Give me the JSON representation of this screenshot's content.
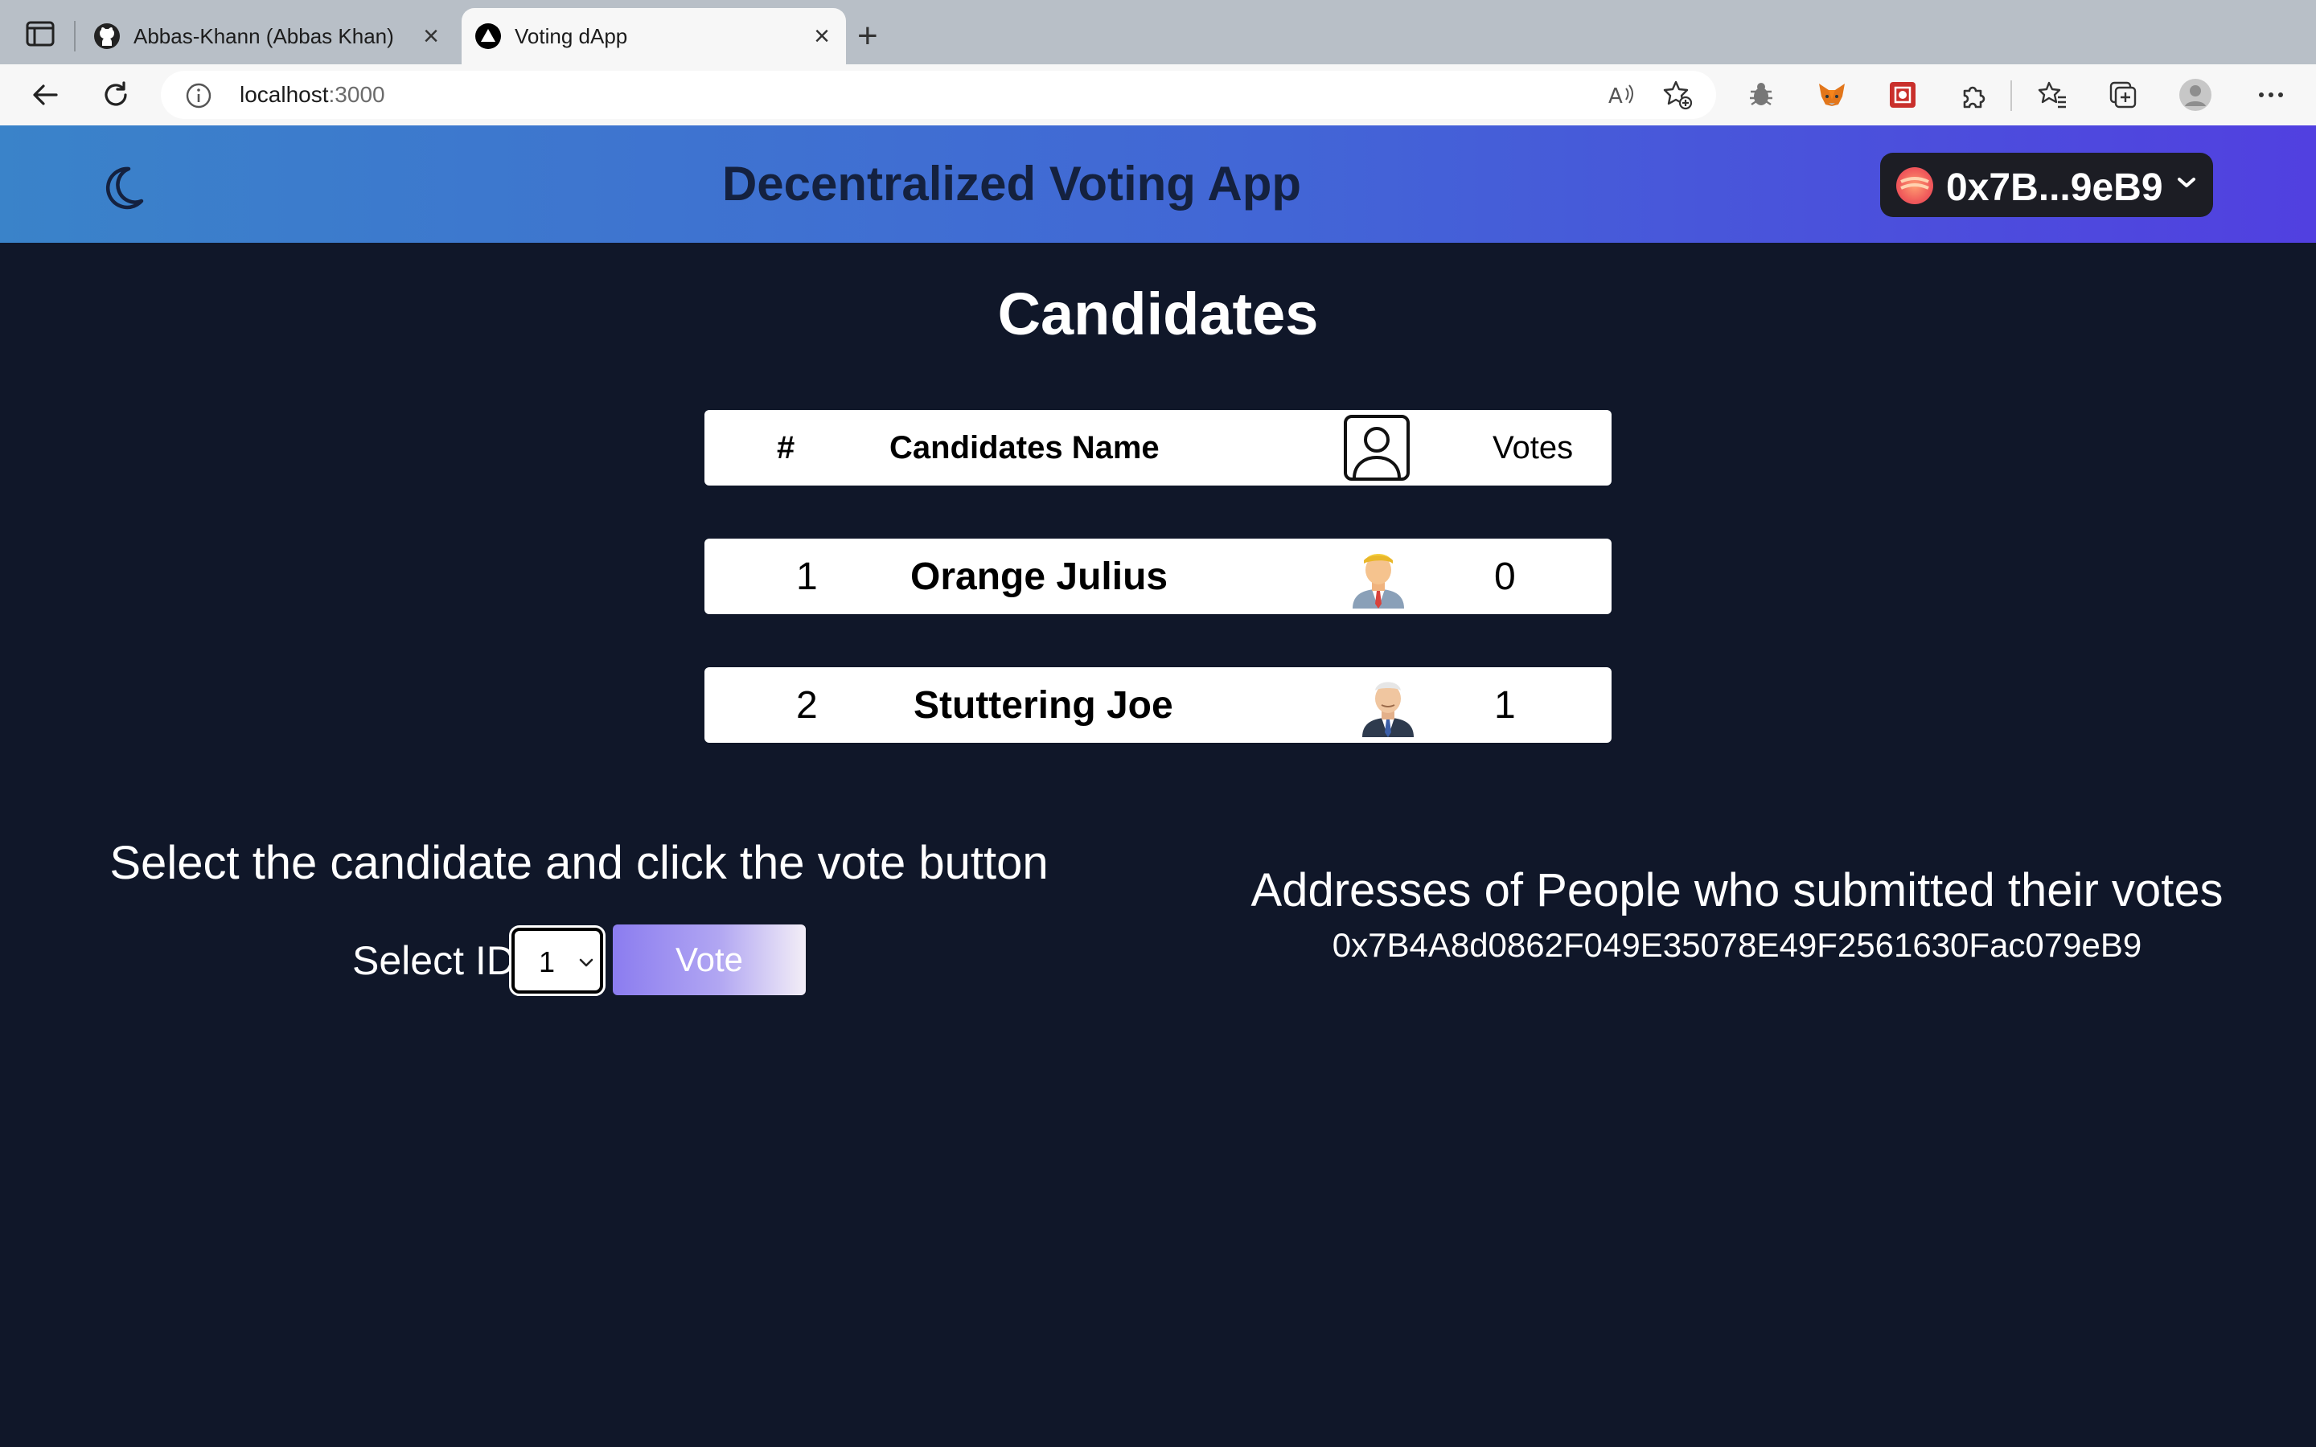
{
  "browser": {
    "tabs": [
      {
        "title": "Abbas-Khann (Abbas Khan)",
        "favicon": "github-icon",
        "active": false
      },
      {
        "title": "Voting dApp",
        "favicon": "app-triangle-icon",
        "active": true
      }
    ],
    "address": {
      "host": "localhost",
      "port": ":3000"
    }
  },
  "header": {
    "title": "Decentralized Voting App",
    "theme_icon": "moon-icon",
    "wallet_label": "0x7B...9eB9"
  },
  "main": {
    "heading": "Candidates",
    "table": {
      "columns": [
        "#",
        "Candidates Name",
        "Votes"
      ],
      "rows": [
        {
          "id": "1",
          "name": "Orange Julius",
          "votes": "0",
          "avatar": "man-blond-suit-emoji"
        },
        {
          "id": "2",
          "name": "Stuttering Joe",
          "votes": "1",
          "avatar": "old-man-suit-emoji"
        }
      ]
    },
    "vote_panel": {
      "instructions": "Select the candidate and click the vote button",
      "select_label": "Select ID",
      "selected_id": "1",
      "vote_label": "Vote"
    },
    "voters_panel": {
      "heading": "Addresses of People who submitted their votes",
      "addresses": [
        "0x7B4A8d0862F049E35078E49F2561630Fac079eB9"
      ]
    }
  },
  "colors": {
    "page_bg": "#101729",
    "header_gradient_start": "#3a83c9",
    "header_gradient_end": "#5140e0",
    "title_color": "#14213f",
    "vote_gradient_start": "#8b7cf0"
  }
}
